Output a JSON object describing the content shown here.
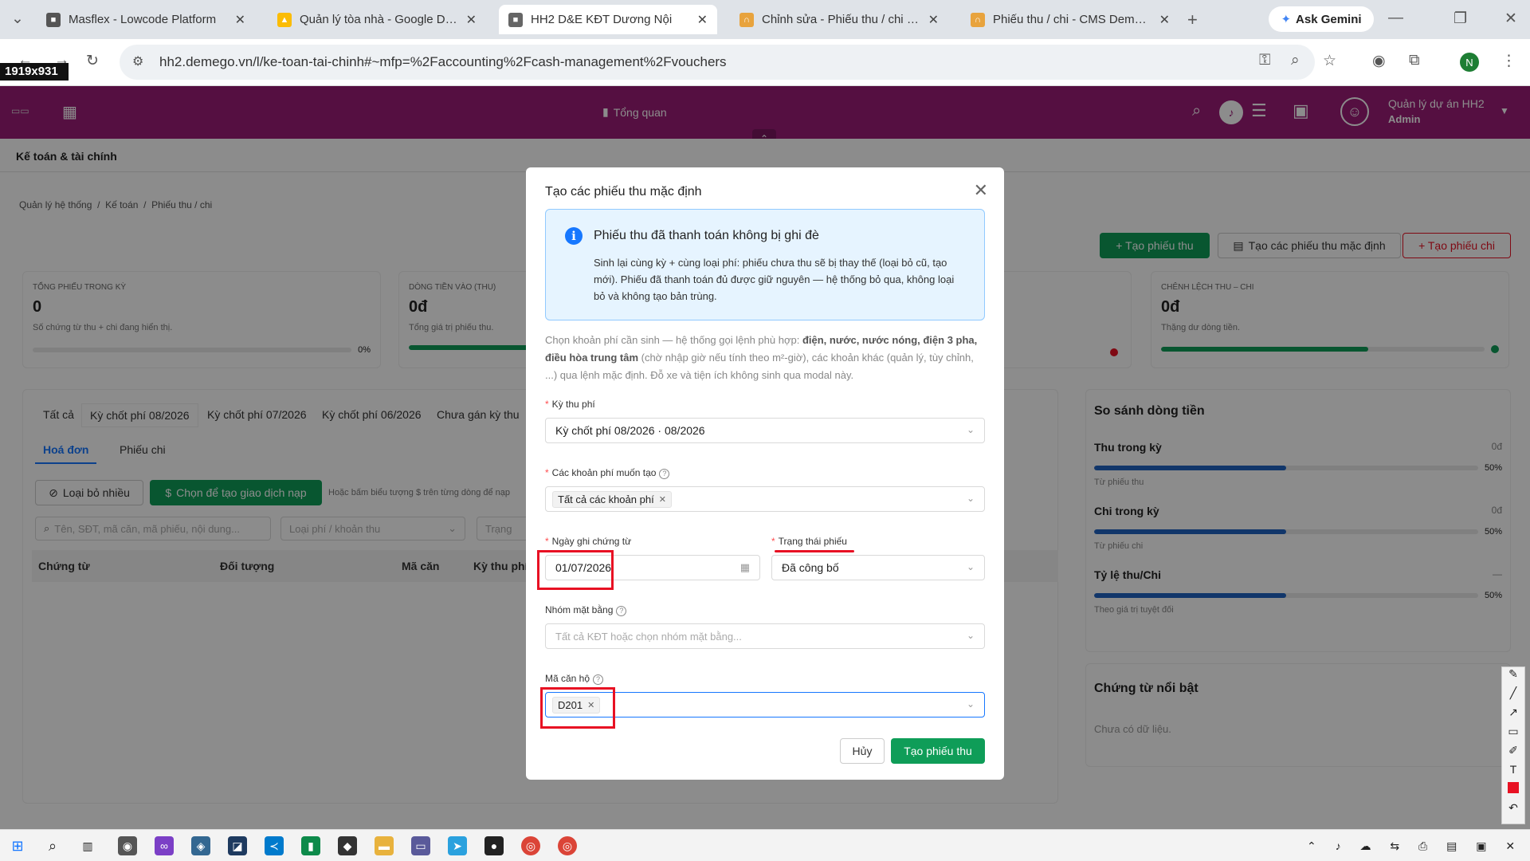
{
  "browser": {
    "tabs": [
      {
        "title": "Masflex - Lowcode Platform"
      },
      {
        "title": "Quản lý tòa nhà - Google Drive"
      },
      {
        "title": "HH2 D&E KĐT Dương Nội"
      },
      {
        "title": "Chỉnh sửa - Phiếu thu / chi - CMS"
      },
      {
        "title": "Phiếu thu / chi - CMS Demego"
      }
    ],
    "new_tab": "+",
    "gemini_label": "Ask Gemini",
    "url": "hh2.demego.vn/l/ke-toan-tai-chinh#~mfp=%2Faccounting%2Fcash-management%2Fvouchers",
    "size_badge": "1919x931",
    "profile_initial": "N"
  },
  "app": {
    "overview_label": "Tổng quan",
    "project_name": "Quản lý dự án HH2",
    "user_role": "Admin",
    "section_title": "Kế toán & tài chính",
    "breadcrumb": [
      "Quản lý hệ thống",
      "Kế toán",
      "Phiếu thu / chi"
    ],
    "actions": {
      "create_receipt": "+ Tạo phiếu thu",
      "create_default": "Tạo các phiếu thu mặc định",
      "create_payment": "+ Tạo phiếu chi"
    },
    "stats": [
      {
        "label": "TỔNG PHIẾU TRONG KỲ",
        "value": "0",
        "hint": "Số chứng từ thu + chi đang hiển thị.",
        "pct": "0%"
      },
      {
        "label": "DÒNG TIỀN VÀO (THU)",
        "value": "0đ",
        "hint": "Tổng giá trị phiếu thu."
      },
      {
        "label": "CHÊNH LỆCH THU – CHI",
        "value": "0đ",
        "hint": "Thặng dư dòng tiền."
      }
    ],
    "period_tabs": [
      "Tất cả",
      "Kỳ chốt phí 08/2026",
      "Kỳ chốt phí 07/2026",
      "Kỳ chốt phí 06/2026",
      "Chưa gán kỳ thu"
    ],
    "doc_tabs": [
      "Hoá đơn",
      "Phiếu chi"
    ],
    "filters": {
      "remove_many": "Loại bỏ nhiều",
      "choose_to_create": "Chọn để tạo giao dịch nạp",
      "helper": "Hoặc bấm biểu tượng $ trên từng dòng để nạp",
      "search_placeholder": "Tên, SĐT, mã căn, mã phiếu, nội dung...",
      "fee_type_placeholder": "Loại phí / khoản thu",
      "status_placeholder": "Trạng"
    },
    "table_headers": [
      "Chứng từ",
      "Đối tượng",
      "Mã căn",
      "Kỳ thu phí"
    ],
    "cashflow": {
      "title": "So sánh dòng tiền",
      "rows": [
        {
          "label": "Thu trong kỳ",
          "value": "0đ",
          "sub": "Từ phiếu thu",
          "pct": "50%",
          "fill": 0.5
        },
        {
          "label": "Chi trong kỳ",
          "value": "0đ",
          "sub": "Từ phiếu chi",
          "pct": "50%",
          "fill": 0.5
        },
        {
          "label": "Tỷ lệ thu/Chi",
          "value": "—",
          "sub": "Theo giá trị tuyệt đối",
          "pct": "50%",
          "fill": 0.5
        }
      ]
    },
    "featured": {
      "title": "Chứng từ nổi bật",
      "empty": "Chưa có dữ liệu."
    }
  },
  "modal": {
    "title": "Tạo các phiếu thu mặc định",
    "info_title": "Phiếu thu đã thanh toán không bị ghi đè",
    "info_body": "Sinh lại cùng kỳ + cùng loại phí: phiếu chưa thu sẽ bị thay thế (loại bỏ cũ, tạo mới). Phiếu đã thanh toán đủ được giữ nguyên — hệ thống bỏ qua, không loại bỏ và không tạo bản trùng.",
    "note_1": "Chọn khoản phí cần sinh — hệ thống gọi lệnh phù hợp: ",
    "note_bold_1": "điện, nước, nước nóng, điện 3 pha, điều hòa trung tâm",
    "note_2": " (chờ nhập giờ nếu tính theo m²-giờ), các khoản khác (quản lý, tùy chỉnh, ...) qua lệnh mặc định. Đỗ xe và tiện ích không sinh qua modal này.",
    "period_label": "Kỳ thu phí",
    "period_value": "Kỳ chốt phí 08/2026 · 08/2026",
    "fees_label": "Các khoản phí muốn tạo",
    "fees_tag": "Tất cả các khoản phí",
    "date_label": "Ngày ghi chứng từ",
    "date_value": "01/07/2026",
    "status_label": "Trạng thái phiếu",
    "status_value": "Đã công bố",
    "group_label": "Nhóm mặt bằng",
    "group_placeholder": "Tất cả KĐT hoặc chọn nhóm mặt bằng...",
    "unit_label": "Mã căn hộ",
    "unit_tag": "D201",
    "cancel": "Hủy",
    "submit": "Tạo phiếu thu"
  },
  "colors": {
    "brand": "#9b1c77",
    "primary": "#0f9d58",
    "danger": "#e81123",
    "info": "#1677ff"
  }
}
